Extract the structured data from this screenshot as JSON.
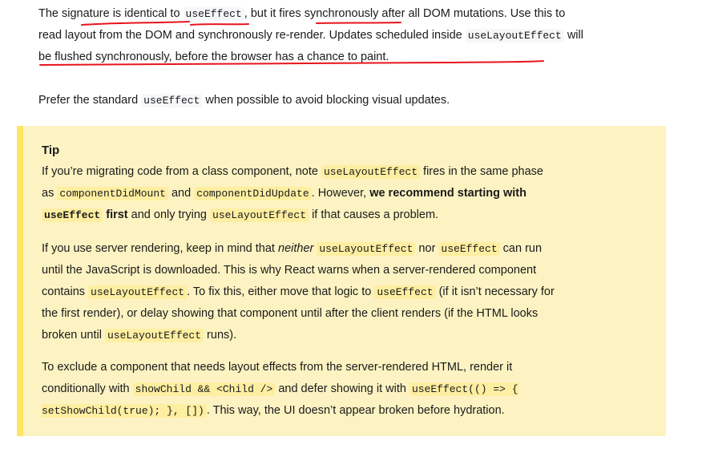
{
  "intro": {
    "p1_a": "The signature is identical to ",
    "p1_code1": "useEffect",
    "p1_b": ", but it fires synchronously after all DOM mutations. Use this to read layout from the DOM and synchronously re-render. Updates scheduled inside ",
    "p1_code2": "useLayoutEffect",
    "p1_c": " will be flushed synchronously, before the browser has a chance to paint.",
    "p2_a": "Prefer the standard ",
    "p2_code1": "useEffect",
    "p2_b": " when possible to avoid blocking visual updates."
  },
  "tip": {
    "title": "Tip",
    "t1_a": "If you’re migrating code from a class component, note ",
    "t1_code1": "useLayoutEffect",
    "t1_b": " fires in the same phase as ",
    "t1_code2": "componentDidMount",
    "t1_c": " and ",
    "t1_code3": "componentDidUpdate",
    "t1_d": ". However, ",
    "t1_strong_a": "we recommend starting with ",
    "t1_strong_code": "useEffect",
    "t1_strong_b": " first",
    "t1_e": " and only trying ",
    "t1_code4": "useLayoutEffect",
    "t1_f": " if that causes a problem.",
    "t2_a": "If you use server rendering, keep in mind that ",
    "t2_em": "neither",
    "t2_b": " ",
    "t2_code1": "useLayoutEffect",
    "t2_c": " nor ",
    "t2_code2": "useEffect",
    "t2_d": " can run until the JavaScript is downloaded. This is why React warns when a server-rendered component contains ",
    "t2_code3": "useLayoutEffect",
    "t2_e": ". To fix this, either move that logic to ",
    "t2_code4": "useEffect",
    "t2_f": " (if it isn’t necessary for the first render), or delay showing that component until after the client renders (if the HTML looks broken until ",
    "t2_code5": "useLayoutEffect",
    "t2_g": " runs).",
    "t3_a": "To exclude a component that needs layout effects from the server-rendered HTML, render it conditionally with ",
    "t3_code1": "showChild && <Child />",
    "t3_b": " and defer showing it with ",
    "t3_code2": "useEffect(() => { setShowChild(true); }, [])",
    "t3_c": ". This way, the UI doesn’t appear broken before hydration."
  },
  "colors": {
    "annotation": "#e8141e",
    "tip_background": "#fdf3c2",
    "tip_border": "#ffe564"
  }
}
